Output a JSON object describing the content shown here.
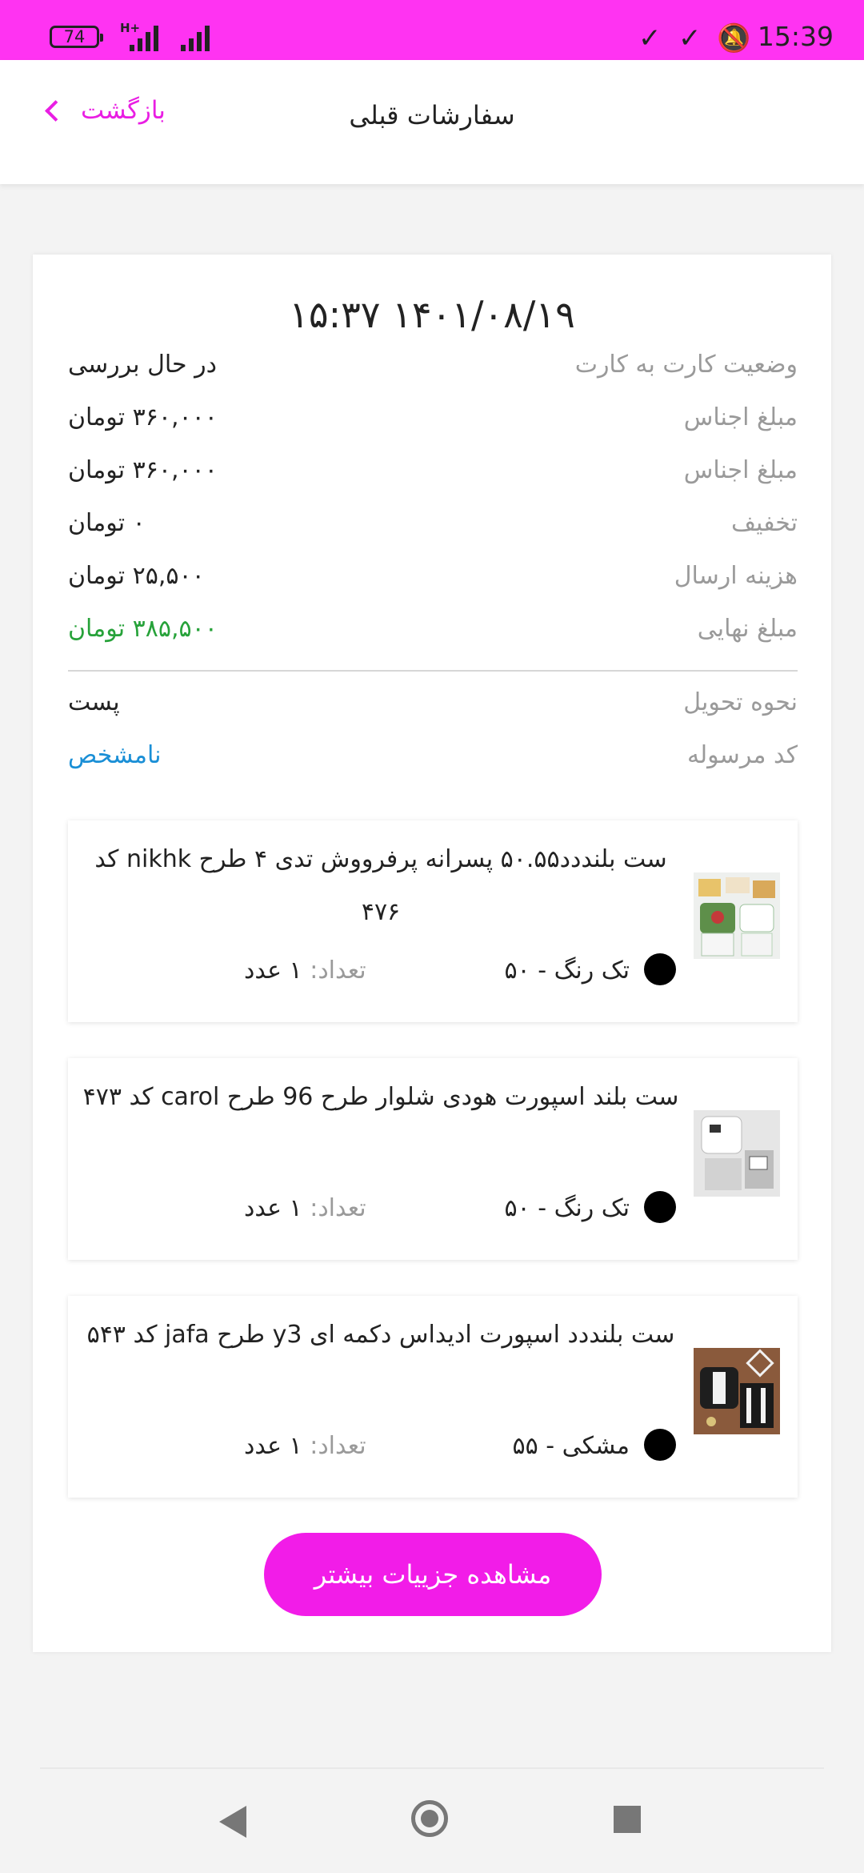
{
  "status_bar": {
    "battery": "74",
    "network": "H+",
    "time": "15:39"
  },
  "header": {
    "title": "سفارشات قبلی",
    "back_label": "بازگشت"
  },
  "order": {
    "datetime": "۱۴۰۱/۰۸/۱۹ ۱۵:۳۷",
    "rows": [
      {
        "label": "وضعیت کارت به کارت",
        "value": "در حال بررسی"
      },
      {
        "label": "مبلغ اجناس",
        "value": "۳۶۰,۰۰۰ تومان"
      },
      {
        "label": "مبلغ اجناس",
        "value": "۳۶۰,۰۰۰ تومان"
      },
      {
        "label": "تخفیف",
        "value": "۰ تومان"
      },
      {
        "label": "هزینه ارسال",
        "value": "۲۵,۵۰۰ تومان"
      },
      {
        "label": "مبلغ نهایی",
        "value": "۳۸۵,۵۰۰ تومان"
      }
    ],
    "delivery": {
      "label": "نحوه تحویل",
      "value": "پست"
    },
    "tracking": {
      "label": "کد مرسوله",
      "value": "نامشخص"
    },
    "items": [
      {
        "name": "ست بلنددد۵۰.۵۵ پسرانه پرفرووش تدی ۴ طرح nikhk کد ۴۷۶",
        "color": "تک رنگ  - ۵۰",
        "qty_label": "تعداد:",
        "qty_value": " ۱ عدد"
      },
      {
        "name": "ست بلند اسپورت هودی شلوار طرح 96 طرح carol کد ۴۷۳",
        "color": "تک رنگ  - ۵۰",
        "qty_label": "تعداد:",
        "qty_value": " ۱ عدد"
      },
      {
        "name": "ست بلنددد اسپورت ادیداس دکمه ای y3 طرح jafa کد ۵۴۳",
        "color": "مشکی  - ۵۵",
        "qty_label": "تعداد:",
        "qty_value": " ۱ عدد"
      }
    ],
    "more_button": "مشاهده جزییات بیشتر"
  },
  "colors": {
    "status_bar": "#ff33f2",
    "accent": "#e91ee3",
    "final_amount": "#27a23a",
    "tracking": "#1a8fd6"
  }
}
